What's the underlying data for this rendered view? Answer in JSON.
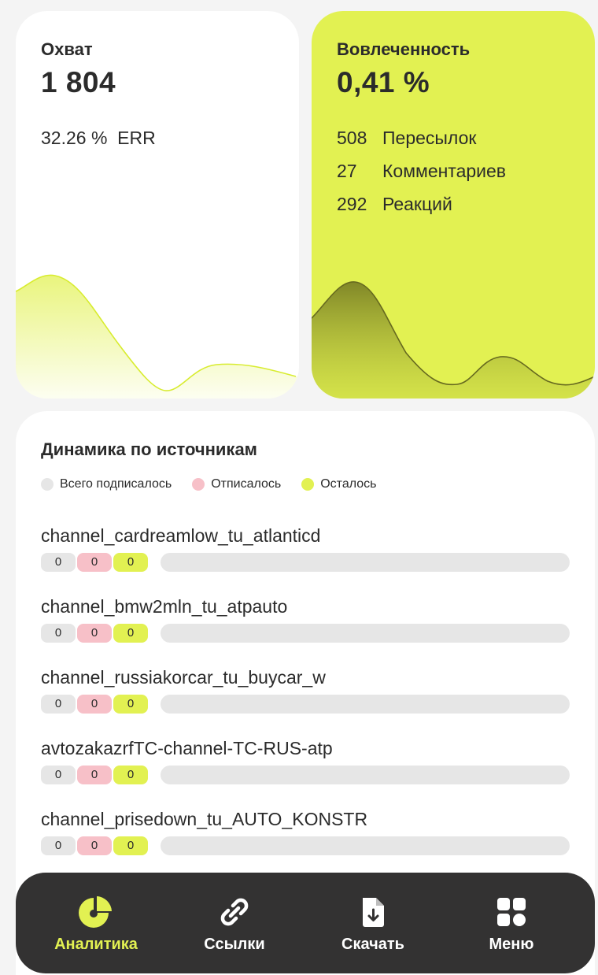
{
  "reach": {
    "title": "Охват",
    "value": "1 804",
    "err": "32.26 %  ERR"
  },
  "engagement": {
    "title": "Вовлеченность",
    "value": "0,41 %",
    "stats": [
      {
        "num": "508",
        "label": "Пересылок"
      },
      {
        "num": "27",
        "label": "Комментариев"
      },
      {
        "num": "292",
        "label": "Реакций"
      }
    ]
  },
  "sources": {
    "title": "Динамика по источникам",
    "legend": [
      {
        "label": "Всего подписалось",
        "color": "#e6e6e6"
      },
      {
        "label": "Отписалось",
        "color": "#f7c0c8"
      },
      {
        "label": "Осталось",
        "color": "#e2f152"
      }
    ],
    "items": [
      {
        "name": "channel_cardreamlow_tu_atlanticd",
        "subscribed": "0",
        "unsubscribed": "0",
        "remained": "0"
      },
      {
        "name": "channel_bmw2mln_tu_atpauto",
        "subscribed": "0",
        "unsubscribed": "0",
        "remained": "0"
      },
      {
        "name": "channel_russiakorcar_tu_buycar_w",
        "subscribed": "0",
        "unsubscribed": "0",
        "remained": "0"
      },
      {
        "name": "avtozakazrfTC-channel-TC-RUS-atp",
        "subscribed": "0",
        "unsubscribed": "0",
        "remained": "0"
      },
      {
        "name": "channel_prisedown_tu_AUTO_KONSTR",
        "subscribed": "0",
        "unsubscribed": "0",
        "remained": "0"
      }
    ]
  },
  "nav": {
    "items": [
      {
        "label": "Аналитика",
        "icon": "pie-chart-icon",
        "active": true
      },
      {
        "label": "Ссылки",
        "icon": "link-icon",
        "active": false
      },
      {
        "label": "Скачать",
        "icon": "download-file-icon",
        "active": false
      },
      {
        "label": "Меню",
        "icon": "grid-menu-icon",
        "active": false
      }
    ]
  },
  "colors": {
    "accent": "#e2f152",
    "unsub": "#f7c0c8",
    "neutral": "#e6e6e6",
    "navbar": "#333232",
    "text": "#2b2b2b"
  }
}
